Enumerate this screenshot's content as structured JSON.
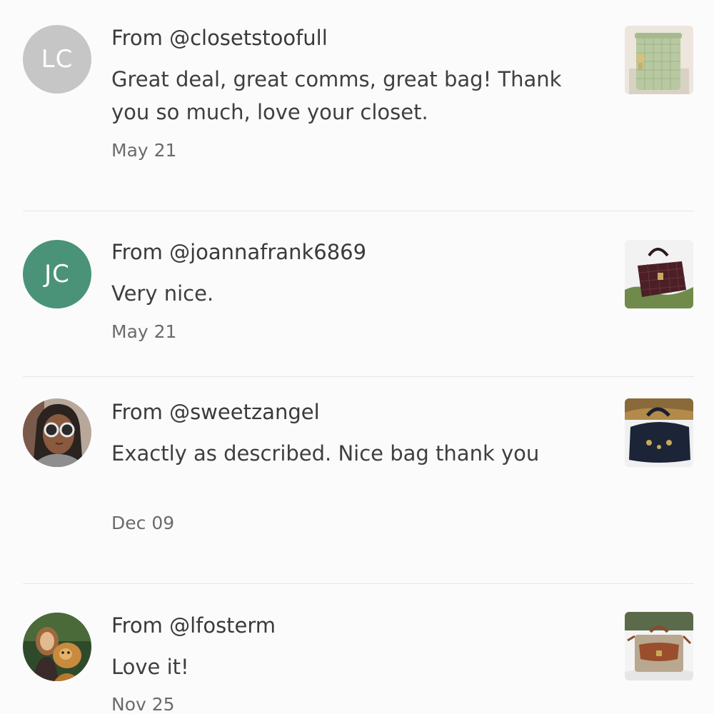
{
  "reviews": [
    {
      "from": "From @closetstoofull",
      "avatar_initials": "LC",
      "avatar_color": "#c6c6c6",
      "message": "Great deal, great comms, great bag! Thank you so much, love your closet.",
      "date": "May 21",
      "thumbnail": "green-croc-crossbody-bag"
    },
    {
      "from": "From @joannafrank6869",
      "avatar_initials": "JC",
      "avatar_color": "#4a9378",
      "message": "Very nice.",
      "date": "May 21",
      "thumbnail": "burgundy-croc-satchel-bag"
    },
    {
      "from": "From @sweetzangel",
      "avatar_photo": "woman-with-sunglasses",
      "message": "Exactly as described.  Nice bag thank you",
      "date": "Dec 09",
      "thumbnail": "navy-leather-satchel-bag"
    },
    {
      "from": "From @lfosterm",
      "avatar_photo": "woman-with-dog",
      "message": "Love it!",
      "date": "Nov 25",
      "thumbnail": "taupe-leather-crossbody-bag"
    }
  ]
}
